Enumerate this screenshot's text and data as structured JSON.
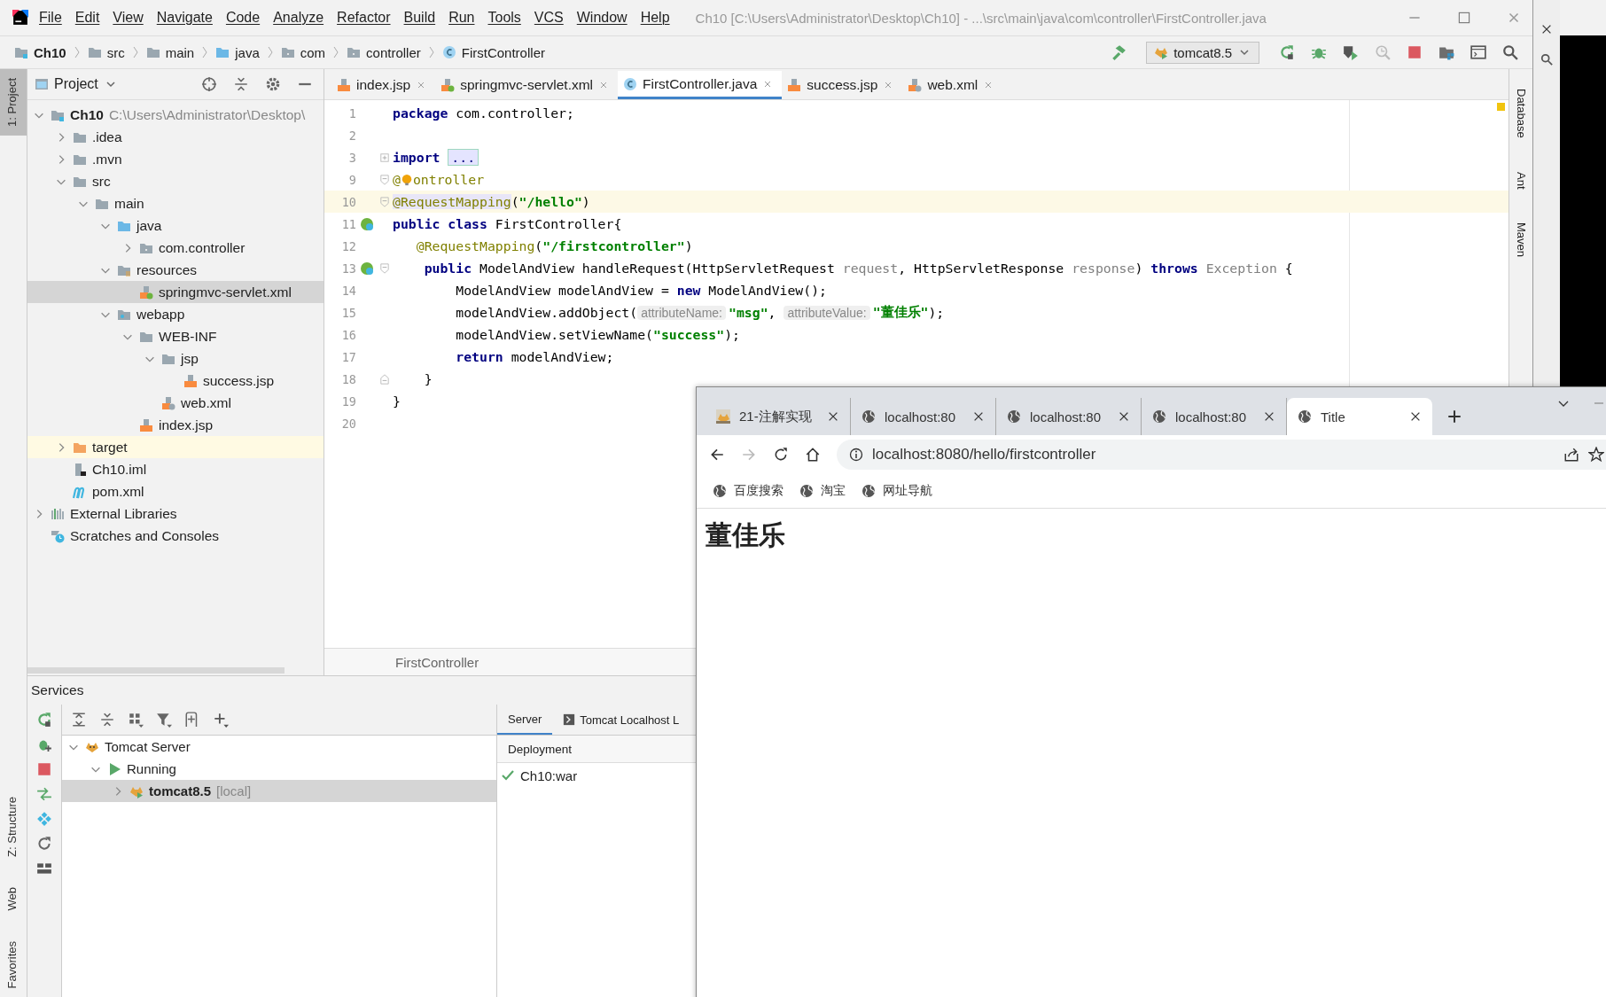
{
  "window": {
    "title": "Ch10 [C:\\Users\\Administrator\\Desktop\\Ch10] - ...\\src\\main\\java\\com\\controller\\FirstController.java"
  },
  "menu": [
    "File",
    "Edit",
    "View",
    "Navigate",
    "Code",
    "Analyze",
    "Refactor",
    "Build",
    "Run",
    "Tools",
    "VCS",
    "Window",
    "Help"
  ],
  "breadcrumbs": [
    {
      "label": "Ch10",
      "kind": "module"
    },
    {
      "label": "src",
      "kind": "folder"
    },
    {
      "label": "main",
      "kind": "folder"
    },
    {
      "label": "java",
      "kind": "source-folder"
    },
    {
      "label": "com",
      "kind": "package"
    },
    {
      "label": "controller",
      "kind": "package"
    },
    {
      "label": "FirstController",
      "kind": "class"
    }
  ],
  "run_config": {
    "label": "tomcat8.5"
  },
  "left_stripe": {
    "top": [
      {
        "label": "1: Project",
        "selected": true
      }
    ],
    "bottom": [
      {
        "label": "Z: Structure",
        "selected": false
      },
      {
        "label": "Web",
        "selected": false
      },
      {
        "label": "Favorites",
        "selected": false
      }
    ]
  },
  "right_stripe": [
    {
      "label": "Database",
      "selected": false
    },
    {
      "label": "Ant",
      "selected": false
    },
    {
      "label": "Maven",
      "selected": false
    }
  ],
  "project_panel": {
    "title": "Project",
    "tree": [
      {
        "label": "Ch10",
        "hint": "C:\\Users\\Administrator\\Desktop\\",
        "kind": "module",
        "expanded": true,
        "selected": false,
        "children": [
          {
            "label": ".idea",
            "kind": "folder",
            "expanded": false,
            "selected": false
          },
          {
            "label": ".mvn",
            "kind": "folder",
            "expanded": false,
            "selected": false
          },
          {
            "label": "src",
            "kind": "folder",
            "expanded": true,
            "selected": false,
            "children": [
              {
                "label": "main",
                "kind": "folder",
                "expanded": true,
                "selected": false,
                "children": [
                  {
                    "label": "java",
                    "kind": "source-folder",
                    "expanded": true,
                    "selected": false,
                    "children": [
                      {
                        "label": "com.controller",
                        "kind": "package",
                        "expanded": false,
                        "selected": false
                      }
                    ]
                  },
                  {
                    "label": "resources",
                    "kind": "resources-folder",
                    "expanded": true,
                    "selected": false,
                    "children": [
                      {
                        "label": "springmvc-servlet.xml",
                        "kind": "spring-xml",
                        "selected": true
                      }
                    ]
                  },
                  {
                    "label": "webapp",
                    "kind": "web-folder",
                    "expanded": true,
                    "selected": false,
                    "children": [
                      {
                        "label": "WEB-INF",
                        "kind": "folder",
                        "expanded": true,
                        "selected": false,
                        "children": [
                          {
                            "label": "jsp",
                            "kind": "folder",
                            "expanded": true,
                            "selected": false,
                            "children": [
                              {
                                "label": "success.jsp",
                                "kind": "jsp",
                                "selected": false
                              }
                            ]
                          },
                          {
                            "label": "web.xml",
                            "kind": "web-xml",
                            "selected": false
                          }
                        ]
                      },
                      {
                        "label": "index.jsp",
                        "kind": "jsp",
                        "selected": false
                      }
                    ]
                  }
                ]
              }
            ]
          },
          {
            "label": "target",
            "kind": "excluded-folder",
            "expanded": false,
            "selected": false
          },
          {
            "label": "Ch10.iml",
            "kind": "iml",
            "selected": false
          },
          {
            "label": "pom.xml",
            "kind": "maven",
            "selected": false
          }
        ]
      },
      {
        "label": "External Libraries",
        "kind": "libraries",
        "expanded": false,
        "selected": false
      },
      {
        "label": "Scratches and Consoles",
        "kind": "scratches",
        "selected": false
      }
    ]
  },
  "editor_tabs": [
    {
      "label": "index.jsp",
      "kind": "jsp",
      "selected": false
    },
    {
      "label": "springmvc-servlet.xml",
      "kind": "spring-xml",
      "selected": false
    },
    {
      "label": "FirstController.java",
      "kind": "class",
      "selected": true
    },
    {
      "label": "success.jsp",
      "kind": "jsp",
      "selected": false
    },
    {
      "label": "web.xml",
      "kind": "web-xml",
      "selected": false
    }
  ],
  "code": [
    {
      "number": "1",
      "current": false,
      "parts": [
        {
          "kind": "keyword",
          "text": "package"
        },
        {
          "kind": "plain",
          "text": " com.controller;"
        }
      ]
    },
    {
      "number": "2",
      "current": false
    },
    {
      "number": "3",
      "current": false,
      "folded": true,
      "parts": [
        {
          "kind": "keyword",
          "text": "import "
        },
        {
          "kind": "folded",
          "text": "..."
        }
      ]
    },
    {
      "number": "9",
      "current": false,
      "fold_start": true,
      "parts": [
        {
          "kind": "annotation",
          "text": "@"
        },
        {
          "kind": "bulb"
        },
        {
          "kind": "annotation",
          "text": "ontroller"
        }
      ]
    },
    {
      "number": "10",
      "current": true,
      "fold_start": true,
      "parts": [
        {
          "kind": "annotation-marked",
          "text": "@RequestMapping"
        },
        {
          "kind": "plain",
          "text": "("
        },
        {
          "kind": "string",
          "text": "\"/hello\""
        },
        {
          "kind": "plain",
          "text": ")"
        }
      ]
    },
    {
      "number": "11",
      "current": false,
      "bean": true,
      "parts": [
        {
          "kind": "keyword",
          "text": "public class"
        },
        {
          "kind": "plain",
          "text": " FirstController{"
        }
      ]
    },
    {
      "number": "12",
      "current": false,
      "parts": [
        {
          "kind": "annotation",
          "text": "   @RequestMapping"
        },
        {
          "kind": "plain",
          "text": "("
        },
        {
          "kind": "string",
          "text": "\"/firstcontroller\""
        },
        {
          "kind": "plain",
          "text": ")"
        }
      ]
    },
    {
      "number": "13",
      "current": false,
      "bean": true,
      "fold_start": true,
      "parts": [
        {
          "kind": "keyword",
          "text": "    public"
        },
        {
          "kind": "plain",
          "text": " ModelAndView handleRequest(HttpServletRequest "
        },
        {
          "kind": "muted",
          "text": "request"
        },
        {
          "kind": "plain",
          "text": ", HttpServletResponse "
        },
        {
          "kind": "muted",
          "text": "response"
        },
        {
          "kind": "plain",
          "text": ") "
        },
        {
          "kind": "keyword",
          "text": "throws "
        },
        {
          "kind": "muted",
          "text": "Exception"
        },
        {
          "kind": "plain",
          "text": " {"
        }
      ]
    },
    {
      "number": "14",
      "current": false,
      "parts": [
        {
          "kind": "plain",
          "text": "        ModelAndView modelAndView = "
        },
        {
          "kind": "keyword",
          "text": "new"
        },
        {
          "kind": "plain",
          "text": " ModelAndView();"
        }
      ]
    },
    {
      "number": "15",
      "current": false,
      "parts": [
        {
          "kind": "plain",
          "text": "        modelAndView.addObject("
        },
        {
          "kind": "hint",
          "text": "attributeName:"
        },
        {
          "kind": "string",
          "text": "\"msg\""
        },
        {
          "kind": "plain",
          "text": ", "
        },
        {
          "kind": "hint",
          "text": "attributeValue:"
        },
        {
          "kind": "string",
          "text": "\"董佳乐\""
        },
        {
          "kind": "plain",
          "text": ");"
        }
      ]
    },
    {
      "number": "16",
      "current": false,
      "parts": [
        {
          "kind": "plain",
          "text": "        modelAndView.setViewName("
        },
        {
          "kind": "string",
          "text": "\"success\""
        },
        {
          "kind": "plain",
          "text": ");"
        }
      ]
    },
    {
      "number": "17",
      "current": false,
      "parts": [
        {
          "kind": "keyword",
          "text": "        return"
        },
        {
          "kind": "plain",
          "text": " modelAndView;"
        }
      ]
    },
    {
      "number": "18",
      "current": false,
      "fold_end": true,
      "parts": [
        {
          "kind": "plain",
          "text": "    }"
        }
      ]
    },
    {
      "number": "19",
      "current": false,
      "parts": [
        {
          "kind": "plain",
          "text": "}"
        }
      ]
    },
    {
      "number": "20",
      "current": false
    }
  ],
  "editor_breadcrumb": "FirstController",
  "services": {
    "title": "Services",
    "tree": [
      {
        "label": "Tomcat Server",
        "kind": "tomcat",
        "expanded": true,
        "selected": false,
        "children": [
          {
            "label": "Running",
            "kind": "running",
            "expanded": true,
            "selected": false,
            "children": [
              {
                "label": "tomcat8.5",
                "hint": "[local]",
                "kind": "tomcat-running",
                "expanded": false,
                "selected": true
              }
            ]
          }
        ]
      }
    ],
    "tabs": [
      {
        "label": "Server",
        "selected": true
      },
      {
        "label": "Tomcat Localhost L",
        "selected": false
      }
    ],
    "deployment": {
      "header": "Deployment",
      "items": [
        {
          "label": "Ch10:war",
          "ok": true
        }
      ]
    }
  },
  "browser": {
    "tabs": [
      {
        "label": "21-注解实现",
        "kind": "picture",
        "selected": false
      },
      {
        "label": "localhost:80",
        "kind": "globe",
        "selected": false
      },
      {
        "label": "localhost:80",
        "kind": "globe",
        "selected": false
      },
      {
        "label": "localhost:80",
        "kind": "globe",
        "selected": false
      },
      {
        "label": "Title",
        "kind": "globe",
        "selected": true
      }
    ],
    "address": "localhost:8080/hello/firstcontroller",
    "bookmarks": [
      "百度搜索",
      "淘宝",
      "网址导航"
    ],
    "page_heading": "董佳乐"
  }
}
